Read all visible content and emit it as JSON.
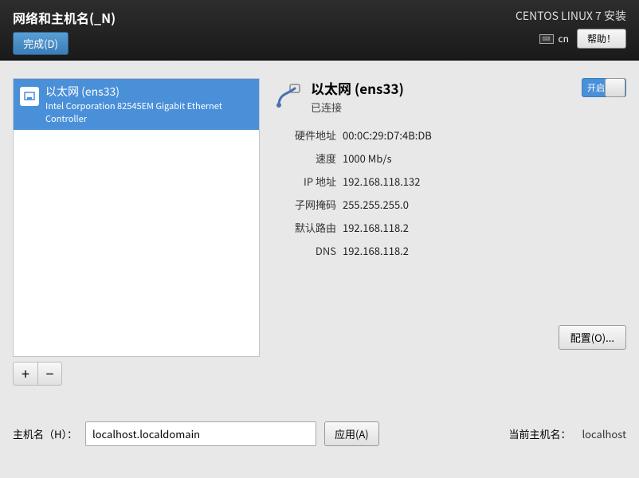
{
  "header": {
    "page_title": "网络和主机名(_N)",
    "done_label": "完成(D)",
    "installer_title": "CENTOS LINUX 7 安装",
    "keyboard_layout": "cn",
    "help_label": "帮助！"
  },
  "nic_list": {
    "items": [
      {
        "title": "以太网 (ens33)",
        "subtitle": "Intel Corporation 82545EM Gigabit Ethernet Controller"
      }
    ],
    "add_label": "+",
    "remove_label": "−"
  },
  "detail": {
    "title": "以太网 (ens33)",
    "status": "已连接",
    "toggle_label": "开启",
    "toggle_on": true,
    "rows": {
      "hw_addr": {
        "label": "硬件地址",
        "value": "00:0C:29:D7:4B:DB"
      },
      "speed": {
        "label": "速度",
        "value": "1000 Mb/s"
      },
      "ip": {
        "label": "IP 地址",
        "value": "192.168.118.132"
      },
      "netmask": {
        "label": "子网掩码",
        "value": "255.255.255.0"
      },
      "gateway": {
        "label": "默认路由",
        "value": "192.168.118.2"
      },
      "dns": {
        "label": "DNS",
        "value": "192.168.118.2"
      }
    },
    "configure_label": "配置(O)..."
  },
  "hostname": {
    "label": "主机名（H）：",
    "value": "localhost.localdomain",
    "apply_label": "应用(A)",
    "current_label": "当前主机名：",
    "current_value": "localhost"
  }
}
